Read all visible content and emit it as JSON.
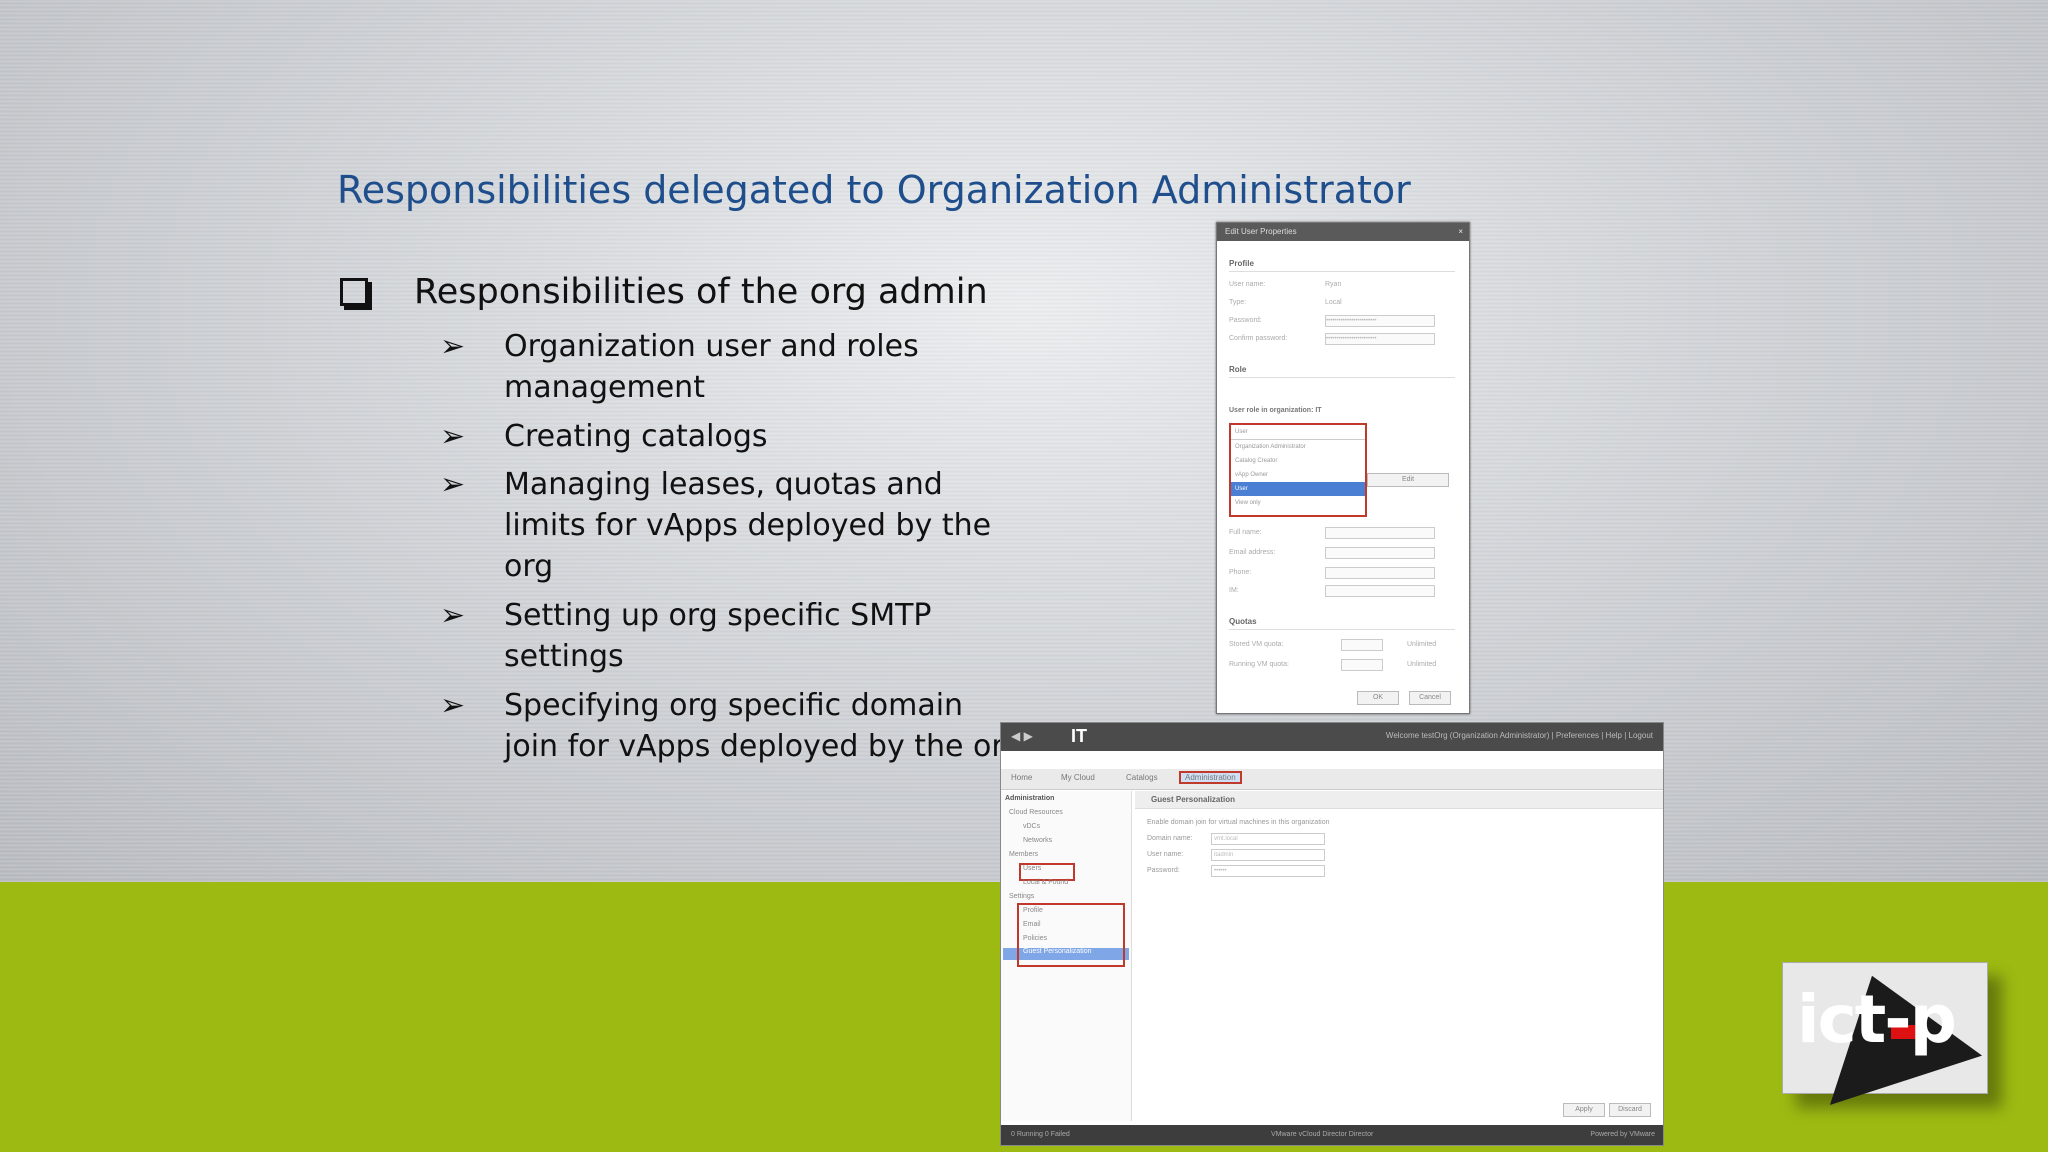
{
  "slide": {
    "title": "Responsibilities delegated to Organization Administrator",
    "main_bullet": "Responsibilities of the org admin",
    "sub_bullets": [
      "Organization user and roles management",
      "Creating catalogs",
      "Managing leases, quotas and limits for vApps deployed by the org",
      "Setting up org specific SMTP settings",
      "Specifying org specific domain join for vApps deployed by the org"
    ],
    "arrow_glyph": "➢",
    "colors": {
      "title": "#1f4e8c",
      "green_band": "#9dba12",
      "highlight_border": "#c0392b"
    }
  },
  "dialog": {
    "title": "Edit User Properties",
    "close": "×",
    "sections": {
      "profile": "Profile",
      "role": "Role",
      "quotas": "Quotas"
    },
    "labels": {
      "user_name": "User name:",
      "type": "Type:",
      "password": "Password:",
      "confirm_password": "Confirm password:",
      "role_in_org": "User role in organization: IT",
      "full_name": "Full name:",
      "email": "Email address:",
      "phone": "Phone:",
      "im": "IM:",
      "stored_vm_quota": "Stored VM quota:",
      "running_vm_quota": "Running VM quota:"
    },
    "values": {
      "user_name": "Ryan",
      "type": "Local",
      "password": "••••••••••••••••••••••••",
      "confirm_password": "••••••••••••••••••••••••"
    },
    "role_options": [
      "User",
      "Organization Administrator",
      "Catalog Creator",
      "vApp Owner",
      "User",
      "View only"
    ],
    "selected_role_index": 4,
    "unlimited": "Unlimited",
    "edit_button": "Edit",
    "ok_button": "OK",
    "cancel_button": "Cancel"
  },
  "vcd": {
    "org_name": "IT",
    "header_links": "Welcome testOrg (Organization Administrator)  |  Preferences  |  Help  |  Logout",
    "tabs": [
      "Home",
      "My Cloud",
      "Catalogs",
      "Administration"
    ],
    "active_tab_index": 3,
    "sidebar": {
      "title": "Administration",
      "items": [
        "Cloud Resources",
        "vDCs",
        "Networks",
        "Members",
        "Users",
        "Local & Found",
        "Settings",
        "Profile",
        "Email",
        "Policies",
        "Guest Personalization"
      ]
    },
    "pane": {
      "title": "Guest Personalization",
      "checkbox_label": "Enable domain join for virtual machines in this organization",
      "domain_label": "Domain name:",
      "domain_value": "vmt.local",
      "username_label": "User name:",
      "username_value": "itadmin",
      "password_label": "Password:",
      "password_value": "••••••"
    },
    "apply_button": "Apply",
    "discard_button": "Discard",
    "footer_left": "0 Running   0 Failed",
    "footer_center": "VMware vCloud Director Director",
    "footer_right": "Powered by VMware"
  },
  "logo": {
    "text": "ict-p"
  }
}
